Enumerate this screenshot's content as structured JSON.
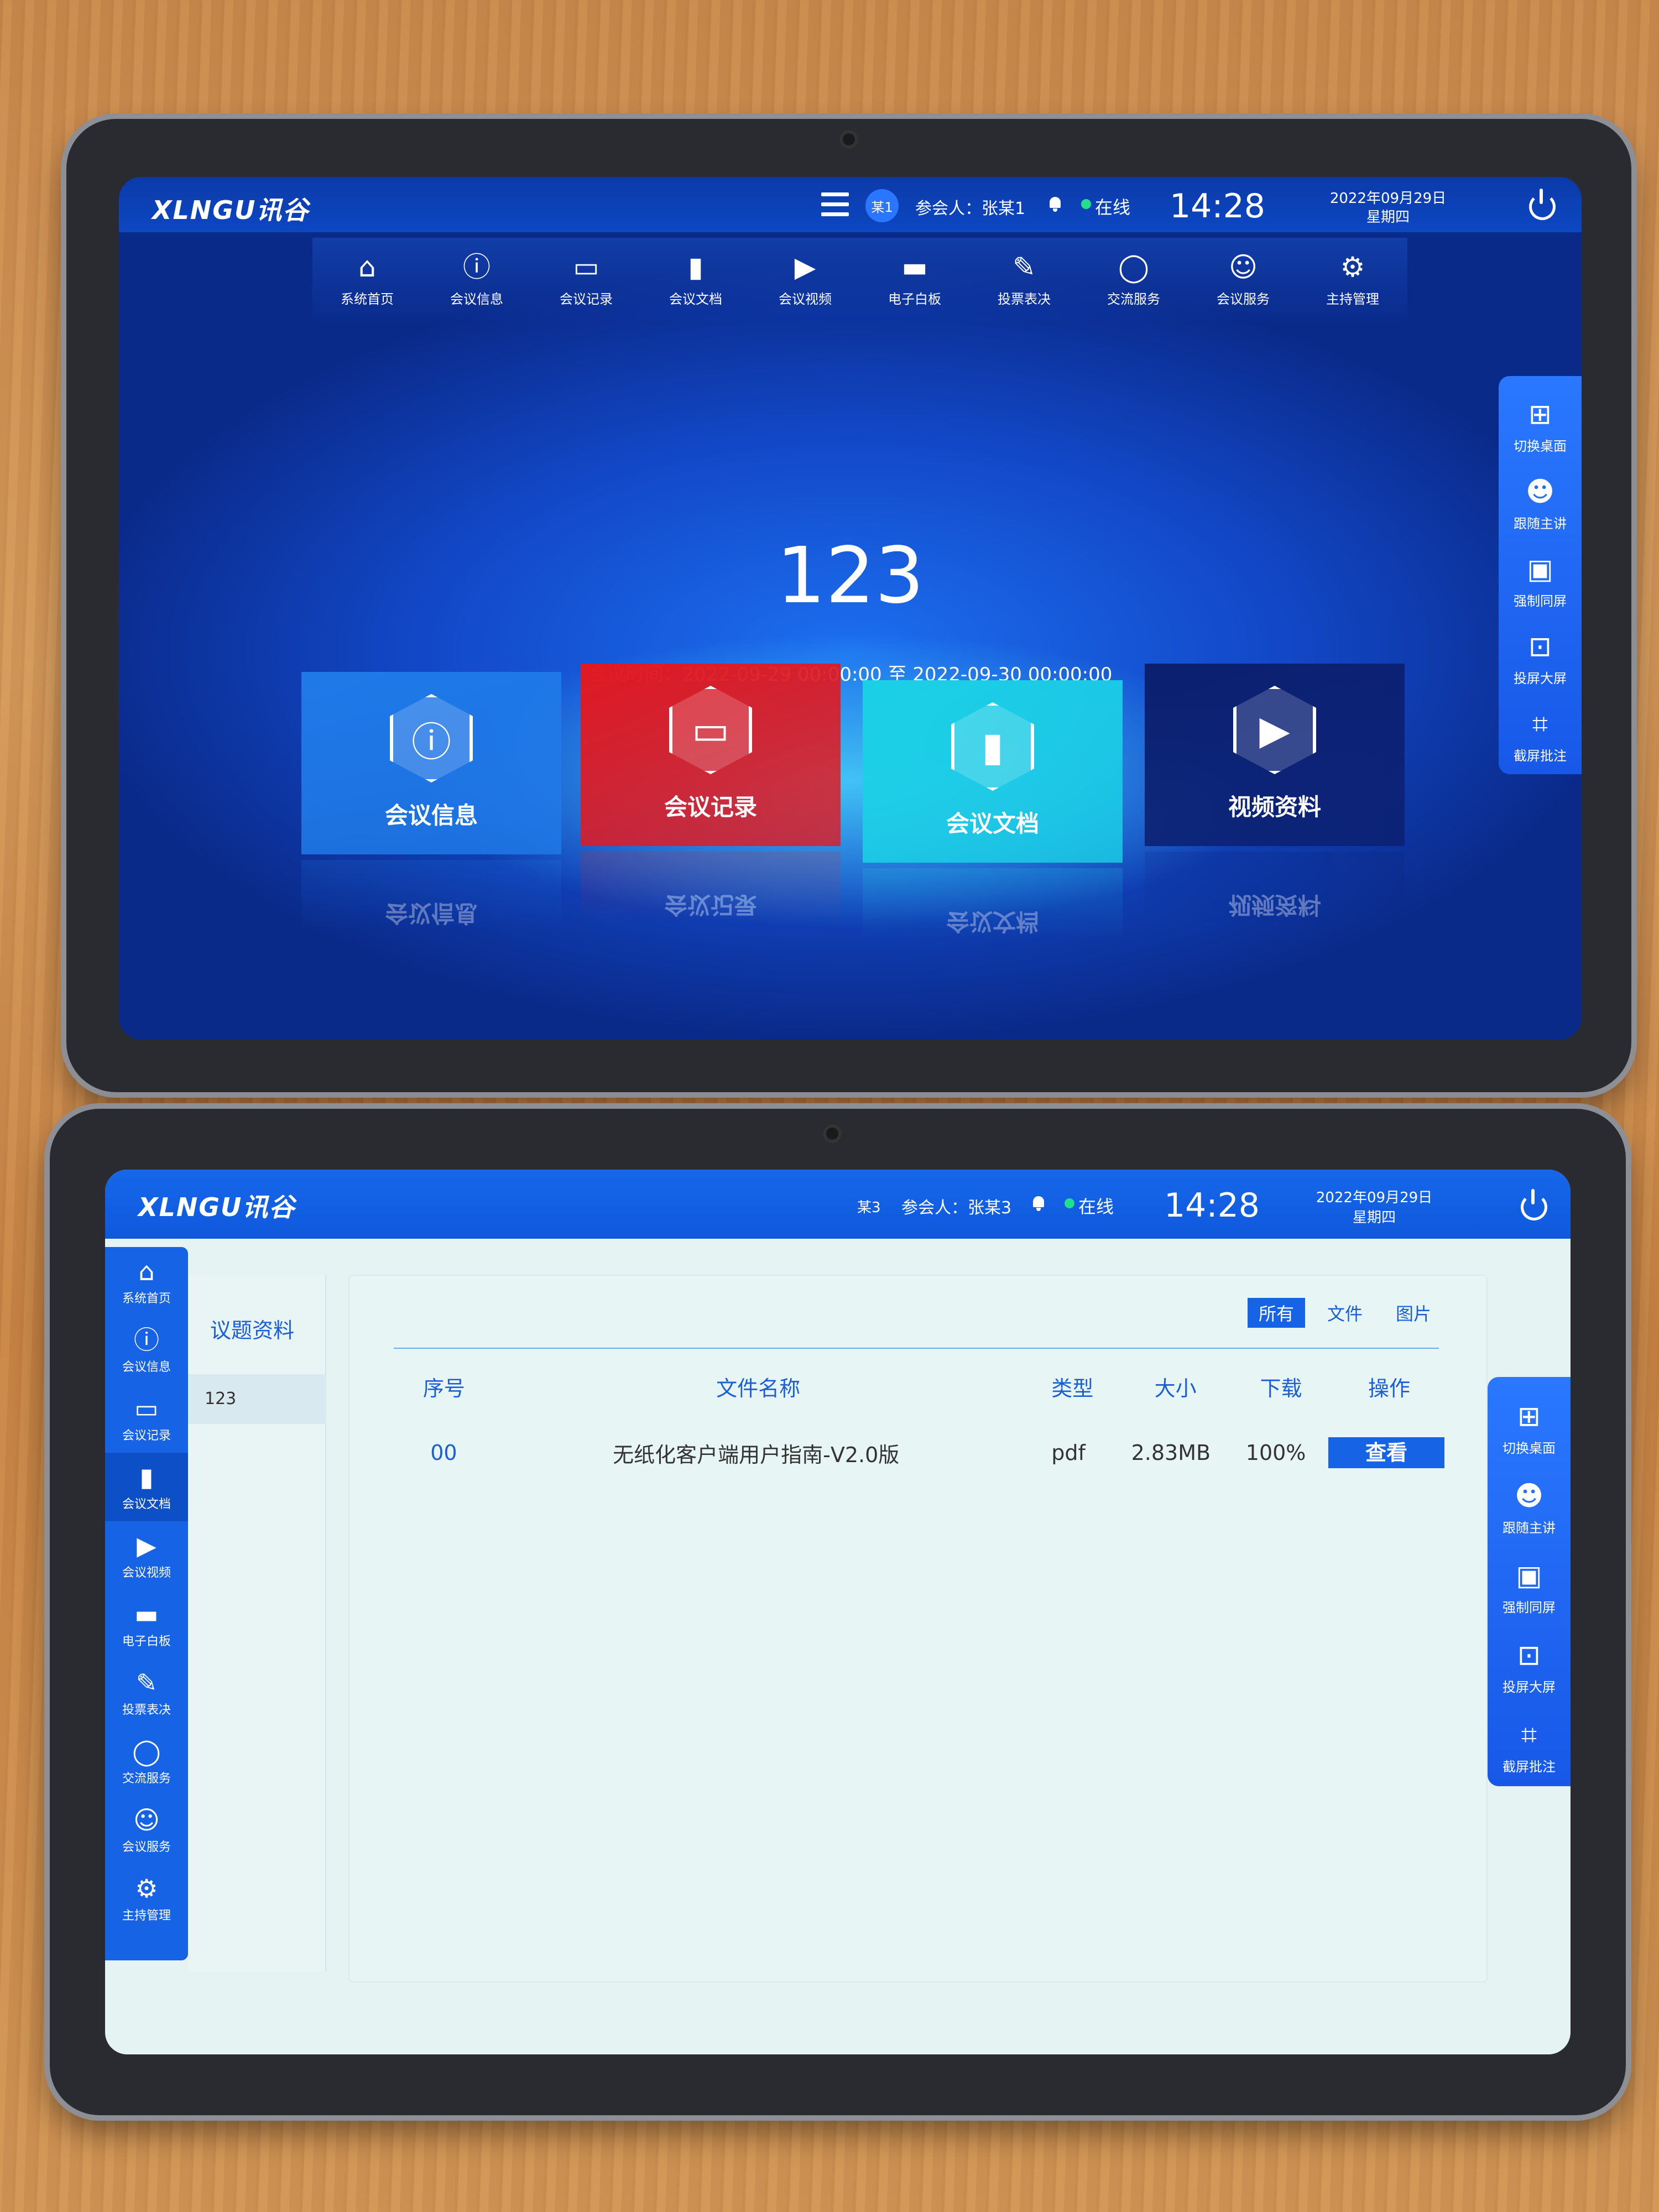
{
  "top_screen": {
    "logo": "XLNGU讯谷",
    "user_badge": "某1",
    "participant": "参会人：张某1",
    "status": "在线",
    "time": "14:28",
    "date": "2022年09月29日",
    "weekday": "星期四",
    "nav": [
      {
        "icon": "home-icon",
        "glyph": "⌂",
        "label": "系统首页"
      },
      {
        "icon": "info-icon",
        "glyph": "ⓘ",
        "label": "会议信息"
      },
      {
        "icon": "laptop-icon",
        "glyph": "▭",
        "label": "会议记录"
      },
      {
        "icon": "clipboard-icon",
        "glyph": "▮",
        "label": "会议文档"
      },
      {
        "icon": "play-icon",
        "glyph": "▶",
        "label": "会议视频"
      },
      {
        "icon": "folder-icon",
        "glyph": "▬",
        "label": "电子白板"
      },
      {
        "icon": "ticket-icon",
        "glyph": "✎",
        "label": "投票表决"
      },
      {
        "icon": "chat-icon",
        "glyph": "◯",
        "label": "交流服务"
      },
      {
        "icon": "smile-icon",
        "glyph": "☺",
        "label": "会议服务"
      },
      {
        "icon": "gear-icon",
        "glyph": "⚙",
        "label": "主持管理"
      }
    ],
    "meeting_title": "123",
    "meeting_time": "会议时间：2022-09-29 00:00:00 至 2022-09-30 00:00:00",
    "cards": [
      {
        "icon": "info-icon",
        "glyph": "ⓘ",
        "label": "会议信息",
        "color": "#1f7ae8"
      },
      {
        "icon": "laptop-icon",
        "glyph": "▭",
        "label": "会议记录",
        "color": "#e01a22"
      },
      {
        "icon": "clipboard-icon",
        "glyph": "▮",
        "label": "会议文档",
        "color": "#1bd0e6"
      },
      {
        "icon": "play-icon",
        "glyph": "▶",
        "label": "视频资料",
        "color": "#0b1f6e"
      }
    ],
    "right_tools": [
      {
        "icon": "grid-icon",
        "glyph": "⊞",
        "label": "切换桌面"
      },
      {
        "icon": "people-icon",
        "glyph": "☻",
        "label": "跟随主讲"
      },
      {
        "icon": "monitor-sync-icon",
        "glyph": "▣",
        "label": "强制同屏"
      },
      {
        "icon": "projector-icon",
        "glyph": "⊡",
        "label": "投屏大屏"
      },
      {
        "icon": "crop-icon",
        "glyph": "⌗",
        "label": "截屏批注"
      }
    ]
  },
  "bottom_screen": {
    "logo": "XLNGU讯谷",
    "user_badge": "某3",
    "participant": "参会人：张某3",
    "status": "在线",
    "time": "14:28",
    "date": "2022年09月29日",
    "weekday": "星期四",
    "left_nav": [
      {
        "icon": "home-icon",
        "glyph": "⌂",
        "label": "系统首页"
      },
      {
        "icon": "info-icon",
        "glyph": "ⓘ",
        "label": "会议信息"
      },
      {
        "icon": "laptop-icon",
        "glyph": "▭",
        "label": "会议记录"
      },
      {
        "icon": "clipboard-icon",
        "glyph": "▮",
        "label": "会议文档"
      },
      {
        "icon": "play-icon",
        "glyph": "▶",
        "label": "会议视频"
      },
      {
        "icon": "folder-icon",
        "glyph": "▬",
        "label": "电子白板"
      },
      {
        "icon": "ticket-icon",
        "glyph": "✎",
        "label": "投票表决"
      },
      {
        "icon": "chat-icon",
        "glyph": "◯",
        "label": "交流服务"
      },
      {
        "icon": "smile-icon",
        "glyph": "☺",
        "label": "会议服务"
      },
      {
        "icon": "gear-icon",
        "glyph": "⚙",
        "label": "主持管理"
      }
    ],
    "subnav_title": "议题资料",
    "subnav_item": "123",
    "filter_tabs": [
      "所有",
      "文件",
      "图片"
    ],
    "table": {
      "headers": [
        "序号",
        "文件名称",
        "类型",
        "大小",
        "下载",
        "操作"
      ],
      "rows": [
        {
          "seq": "00",
          "name": "无纸化客户端用户指南-V2.0版",
          "type": "pdf",
          "size": "2.83MB",
          "download": "100%",
          "action": "查看"
        }
      ]
    },
    "right_tools": [
      {
        "icon": "grid-icon",
        "glyph": "⊞",
        "label": "切换桌面"
      },
      {
        "icon": "people-icon",
        "glyph": "☻",
        "label": "跟随主讲"
      },
      {
        "icon": "monitor-sync-icon",
        "glyph": "▣",
        "label": "强制同屏"
      },
      {
        "icon": "projector-icon",
        "glyph": "⊡",
        "label": "投屏大屏"
      },
      {
        "icon": "crop-icon",
        "glyph": "⌗",
        "label": "截屏批注"
      }
    ]
  }
}
